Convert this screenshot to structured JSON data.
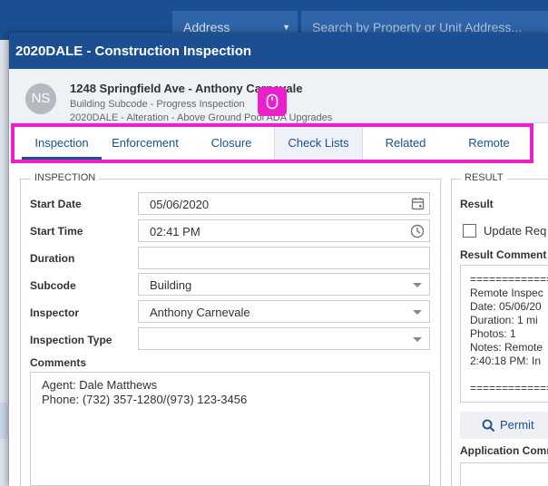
{
  "background": {
    "address_label": "Address",
    "search_placeholder": "Search by Property or Unit Address..."
  },
  "modal": {
    "title": "2020DALE - Construction Inspection"
  },
  "header": {
    "avatar_initials": "NS",
    "title": "1248 Springfield Ave - Anthony Carnevale",
    "subtitle1": "Building Subcode - Progress Inspection",
    "subtitle2": "2020DALE - Alteration - Above Ground Pool ADA Upgrades"
  },
  "tabs": [
    {
      "label": "Inspection"
    },
    {
      "label": "Enforcement"
    },
    {
      "label": "Closure"
    },
    {
      "label": "Check Lists"
    },
    {
      "label": "Related"
    },
    {
      "label": "Remote"
    }
  ],
  "inspection": {
    "legend": "INSPECTION",
    "start_date_label": "Start Date",
    "start_date": "05/06/2020",
    "start_time_label": "Start Time",
    "start_time": "02:41 PM",
    "duration_label": "Duration",
    "duration": "",
    "subcode_label": "Subcode",
    "subcode": "Building",
    "inspector_label": "Inspector",
    "inspector": "Anthony Carnevale",
    "inspection_type_label": "Inspection Type",
    "inspection_type": "",
    "comments_label": "Comments",
    "comments_line1": "Agent: Dale Matthews",
    "comments_line2": "Phone: (732) 357-1280/(973) 123-3456"
  },
  "result": {
    "legend": "RESULT",
    "result_label": "Result",
    "update_label": "Update Req",
    "result_comment_label": "Result Comment",
    "comment_lines": [
      "===============",
      "Remote Inspec",
      "Date: 05/06/20",
      "Duration: 1 mi",
      "Photos: 1",
      "Notes: Remote",
      "2:40:18 PM: In",
      "",
      "==============="
    ],
    "permit_button": "Permit",
    "application_comment_label": "Application Comm"
  },
  "colors": {
    "primary": "#1c4f92",
    "highlight": "#ea20ca"
  }
}
